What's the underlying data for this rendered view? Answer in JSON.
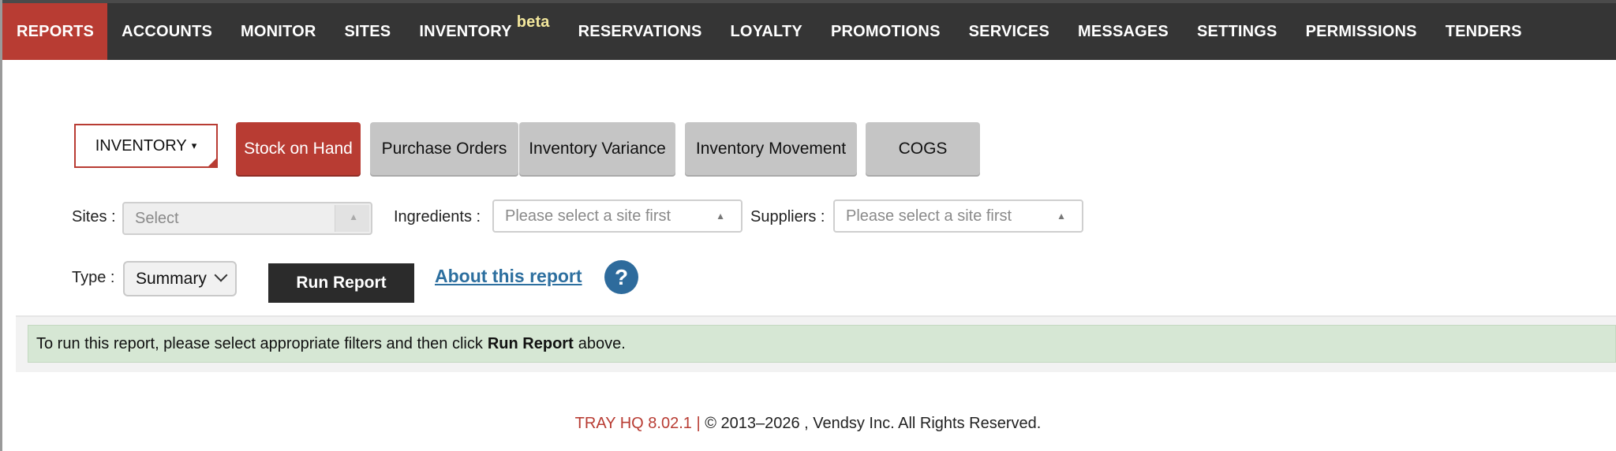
{
  "topnav": {
    "items": [
      {
        "label": "REPORTS"
      },
      {
        "label": "ACCOUNTS"
      },
      {
        "label": "MONITOR"
      },
      {
        "label": "SITES"
      },
      {
        "label": "INVENTORY",
        "badge": "beta"
      },
      {
        "label": "RESERVATIONS"
      },
      {
        "label": "LOYALTY"
      },
      {
        "label": "PROMOTIONS"
      },
      {
        "label": "SERVICES"
      },
      {
        "label": "MESSAGES"
      },
      {
        "label": "SETTINGS"
      },
      {
        "label": "PERMISSIONS"
      },
      {
        "label": "TENDERS"
      }
    ],
    "active": "REPORTS"
  },
  "report_module": {
    "label": "INVENTORY",
    "caret": "▾"
  },
  "tabs": [
    {
      "label": "Stock on Hand",
      "active": true
    },
    {
      "label": "Purchase Orders"
    },
    {
      "label": "Inventory Variance"
    },
    {
      "label": "Inventory Movement"
    },
    {
      "label": "COGS"
    }
  ],
  "filters": {
    "sites": {
      "label": "Sites :",
      "placeholder": "Select"
    },
    "ingredients": {
      "label": "Ingredients :",
      "placeholder": "Please select a site first"
    },
    "suppliers": {
      "label": "Suppliers :",
      "placeholder": "Please select a site first"
    },
    "type": {
      "label": "Type :",
      "value": "Summary"
    }
  },
  "actions": {
    "run_report": "Run Report",
    "about": "About this report",
    "help": "?"
  },
  "notice": {
    "prefix": "To run this report, please select appropriate filters and then click",
    "bold": "Run Report",
    "suffix": "above."
  },
  "footer": {
    "version": "TRAY HQ 8.02.1 |",
    "copyright": "© 2013–2026 , Vendsy Inc. All Rights Reserved."
  },
  "colors": {
    "accent": "#b83c33",
    "nav_bg": "#353535",
    "link": "#2d6f9f",
    "notice_bg": "#d6e7d4"
  }
}
